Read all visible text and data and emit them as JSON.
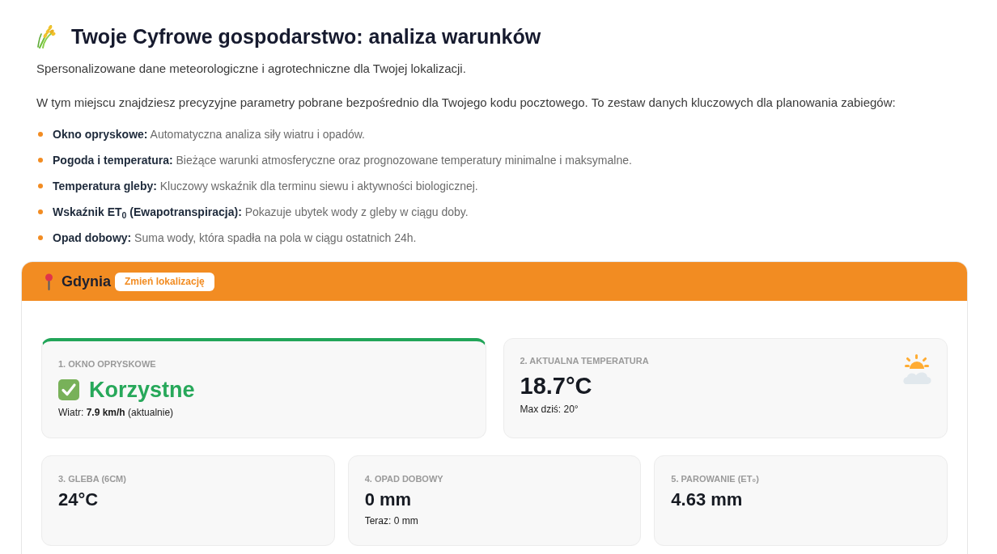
{
  "header": {
    "title": "Twoje Cyfrowe gospodarstwo: analiza warunków",
    "subtitle": "Spersonalizowane dane meteorologiczne i agrotechniczne dla Twojej lokalizacji.",
    "intro": "W tym miejscu znajdziesz precyzyjne parametry pobrane bezpośrednio dla Twojego kodu pocztowego. To zestaw danych kluczowych dla planowania zabiegów:"
  },
  "features": [
    "**Okno opryskowe:** Automatyczna analiza siły wiatru i opadów.",
    "**Pogoda i temperatura:** Bieżące warunki atmosferyczne oraz prognozowane temperatury minimalne i maksymalne.",
    "**Temperatura gleby:** Kluczowy wskaźnik dla terminu siewu i aktywności biologicznej.",
    "**Wskaźnik ET$_{0}$ (Ewapotranspiracja):** Pokazuje ubytek wody z gleby w ciągu doby.",
    "**Opad dobowy:** Suma wody, która spadła na pola w ciągu ostatnich 24h."
  ],
  "location": {
    "city": "Gdynia",
    "change_button": "Zmień lokalizację"
  },
  "card_rows": [
    [
      {
        "kind": "status",
        "label": "1. OKNO OPRYSKOWE",
        "value": "Korzystne",
        "detail": "Wiatr: **7.9 km/h** (aktualnie)"
      },
      {
        "kind": "weather",
        "label": "2. AKTUALNA TEMPERATURA",
        "value": "18.7°C",
        "detail": "Max dziś: 20°"
      }
    ],
    [
      {
        "kind": "metric",
        "label": "3. GLEBA (6CM)",
        "value": "24°C"
      },
      {
        "kind": "metric",
        "label": "4. OPAD DOBOWY",
        "value": "0 mm",
        "detail": "Teraz: 0 mm"
      },
      {
        "kind": "metric",
        "label": "5. PAROWANIE (ET₀)",
        "value": "4.63 mm"
      }
    ]
  ]
}
